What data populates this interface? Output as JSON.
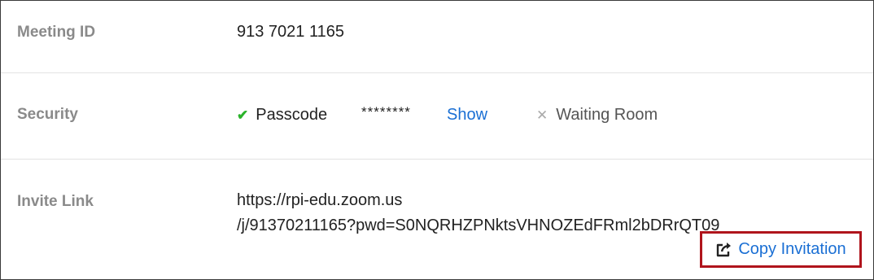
{
  "meeting": {
    "label": "Meeting ID",
    "id": "913 7021 1165"
  },
  "security": {
    "label": "Security",
    "passcode_label": "Passcode",
    "passcode_masked": "********",
    "show_label": "Show",
    "waiting_room_label": "Waiting Room"
  },
  "invite": {
    "label": "Invite Link",
    "link_line1": "https://rpi-edu.zoom.us",
    "link_line2": "/j/91370211165?pwd=S0NQRHZPNktsVHNOZEdFRml2bDRrQT09",
    "copy_label": "Copy Invitation"
  },
  "colors": {
    "accent": "#1a6fd4",
    "check": "#2ab32a",
    "highlight": "#b0141c"
  },
  "icons": {
    "passcode_status": "check-icon",
    "waiting_room_status": "x-icon",
    "copy": "share-icon"
  }
}
